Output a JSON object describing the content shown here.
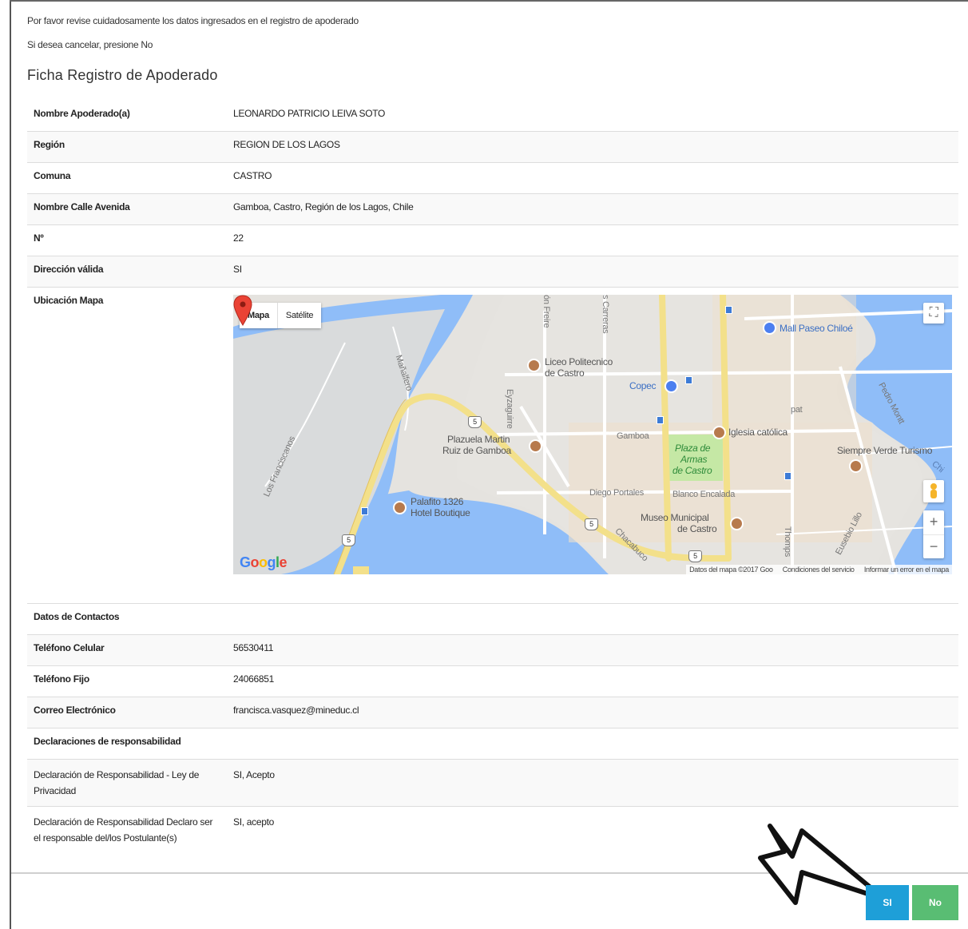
{
  "notice": {
    "line1": "Por favor revise cuidadosamente los datos ingresados en el registro de apoderado",
    "line2": "Si desea cancelar, presione No"
  },
  "title": "Ficha Registro de Apoderado",
  "fields": {
    "nombre": {
      "label": "Nombre Apoderado(a)",
      "value": "LEONARDO PATRICIO LEIVA SOTO"
    },
    "region": {
      "label": "Región",
      "value": "REGION DE LOS LAGOS"
    },
    "comuna": {
      "label": "Comuna",
      "value": "CASTRO"
    },
    "calle": {
      "label": "Nombre Calle Avenida",
      "value": "Gamboa, Castro, Región de los Lagos, Chile"
    },
    "numero": {
      "label": "Nº",
      "value": "22"
    },
    "direccion_valida": {
      "label": "Dirección válida",
      "value": "SI"
    },
    "ubicacion": {
      "label": "Ubicación Mapa"
    }
  },
  "contact": {
    "section": "Datos de Contactos",
    "celular": {
      "label": "Teléfono Celular",
      "value": "56530411"
    },
    "fijo": {
      "label": "Teléfono Fijo",
      "value": "24066851"
    },
    "correo": {
      "label": "Correo Electrónico",
      "value": "francisca.vasquez@mineduc.cl"
    }
  },
  "declarations": {
    "section": "Declaraciones de responsabilidad",
    "privacidad": {
      "label": "Declaración de Responsabilidad - Ley de Privacidad",
      "value": "SI, Acepto"
    },
    "postulante": {
      "label": "Declaración de Responsabilidad Declaro ser el responsable del/los Postulante(s)",
      "value": "SI, acepto"
    }
  },
  "map": {
    "type_buttons": [
      "Mapa",
      "Satélite"
    ],
    "labels": {
      "mall": "Mall Paseo Chiloé",
      "liceo1": "Liceo Politecnico",
      "liceo2": "de Castro",
      "copec": "Copec",
      "gamboa": "Gamboa",
      "iglesia": "Iglesia católica",
      "plazuela1": "Plazuela Martin",
      "plazuela2": "Ruiz de Gamboa",
      "plaza1": "Plaza de",
      "plaza2": "Armas",
      "plaza3": "de Castro",
      "siempre_verde": "Siempre Verde Turismo",
      "diego_portales": "Diego Portales",
      "blanco": "Blanco Encalada",
      "palafito1": "Palafito 1326",
      "palafito2": "Hotel Boutique",
      "museo1": "Museo Municipal",
      "museo2": "de Castro",
      "eyzaguirre": "Eyzaguirre",
      "carreras": "s Carreras",
      "freire": "ón Freire",
      "pedro_montt": "Pedro Montt",
      "eusebio": "Eusebio Lillo",
      "thompson": "Thomps",
      "chacabuco": "Chacabuco",
      "los_franciscanos": "Los Franciscanos",
      "manuel": "Mañalfero",
      "chi": "Chi",
      "pat": "pat"
    },
    "route_number": "5",
    "google": "Google",
    "attribution": [
      "Datos del mapa ©2017 Goo",
      "Condiciones del servicio",
      "Informar un error en el mapa"
    ],
    "colors": {
      "land": "#e5e3df",
      "water": "#8fbdf8",
      "road": "#f3e08a",
      "park": "#c5e8a5"
    }
  },
  "buttons": {
    "si": "SI",
    "no": "No"
  },
  "colors": {
    "si": "#1e9fd8",
    "no": "#59bd73"
  }
}
